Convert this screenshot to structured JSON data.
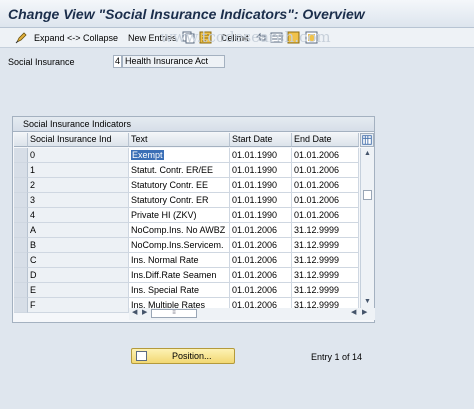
{
  "title": "Change View \"Social Insurance Indicators\": Overview",
  "toolbar": {
    "expand_collapse": "Expand <-> Collapse",
    "new_entries": "New Entries",
    "delimit": "Delimit"
  },
  "watermark": "www.tcodesearch.com",
  "selection": {
    "label": "Social Insurance",
    "key": "4",
    "text": "Health Insurance Act"
  },
  "panel": {
    "title": "Social Insurance Indicators",
    "columns": [
      "Social Insurance Ind",
      "Text",
      "Start Date",
      "End Date"
    ],
    "rows": [
      {
        "ind": "0",
        "text": "Exempt",
        "start": "01.01.1990",
        "end": "01.01.2006"
      },
      {
        "ind": "1",
        "text": "Statut. Contr. ER/EE",
        "start": "01.01.1990",
        "end": "01.01.2006"
      },
      {
        "ind": "2",
        "text": "Statutory Contr. EE",
        "start": "01.01.1990",
        "end": "01.01.2006"
      },
      {
        "ind": "3",
        "text": "Statutory Contr. ER",
        "start": "01.01.1990",
        "end": "01.01.2006"
      },
      {
        "ind": "4",
        "text": "Private HI (ZKV)",
        "start": "01.01.1990",
        "end": "01.01.2006"
      },
      {
        "ind": "A",
        "text": "NoComp.Ins. No AWBZ",
        "start": "01.01.2006",
        "end": "31.12.9999"
      },
      {
        "ind": "B",
        "text": "NoComp.Ins.Servicem.",
        "start": "01.01.2006",
        "end": "31.12.9999"
      },
      {
        "ind": "C",
        "text": "Ins. Normal Rate",
        "start": "01.01.2006",
        "end": "31.12.9999"
      },
      {
        "ind": "D",
        "text": "Ins.Diff.Rate Seamen",
        "start": "01.01.2006",
        "end": "31.12.9999"
      },
      {
        "ind": "E",
        "text": "Ins. Special Rate",
        "start": "01.01.2006",
        "end": "31.12.9999"
      },
      {
        "ind": "F",
        "text": "Ins. Multiple Rates",
        "start": "01.01.2006",
        "end": "31.12.9999"
      }
    ]
  },
  "position_button": "Position...",
  "entry_status": "Entry 1 of 14"
}
